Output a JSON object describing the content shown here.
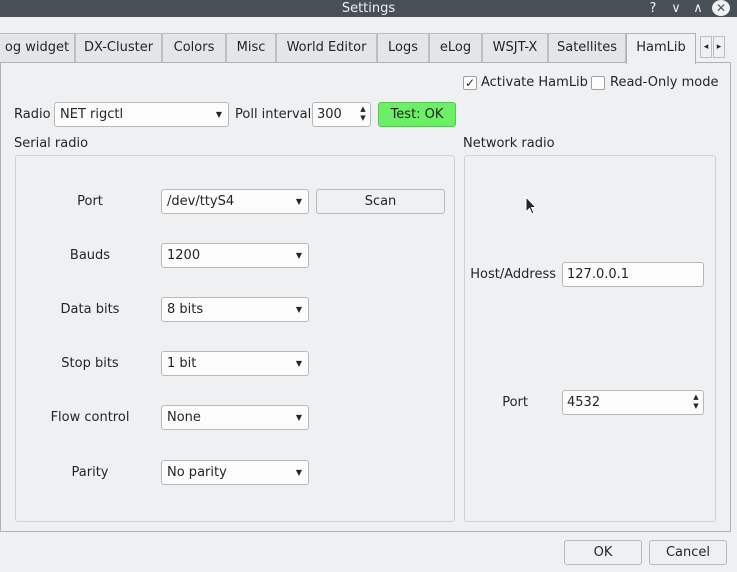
{
  "window": {
    "title": "Settings",
    "help_glyph": "?",
    "minimize_glyph": "∨",
    "maximize_glyph": "∧",
    "close_glyph": "✕"
  },
  "tabs": [
    {
      "label": "og widget",
      "active": false
    },
    {
      "label": "DX-Cluster",
      "active": false
    },
    {
      "label": "Colors",
      "active": false
    },
    {
      "label": "Misc",
      "active": false
    },
    {
      "label": "World Editor",
      "active": false
    },
    {
      "label": "Logs",
      "active": false
    },
    {
      "label": "eLog",
      "active": false
    },
    {
      "label": "WSJT-X",
      "active": false
    },
    {
      "label": "Satellites",
      "active": false
    },
    {
      "label": "HamLib",
      "active": true
    }
  ],
  "tab_scroll": {
    "left": "◂",
    "right": "▸"
  },
  "hamlib": {
    "activate": {
      "label": "Activate HamLib",
      "checked": true,
      "check_glyph": "✓"
    },
    "readonly": {
      "label": "Read-Only mode",
      "checked": false
    },
    "radio_label": "Radio",
    "radio_value": "NET rigctl",
    "poll_label": "Poll interval",
    "poll_value": "300",
    "test_button": "Test: OK",
    "serial": {
      "title": "Serial radio",
      "port_label": "Port",
      "port_value": "/dev/ttyS4",
      "scan_button": "Scan",
      "bauds_label": "Bauds",
      "bauds_value": "1200",
      "databits_label": "Data bits",
      "databits_value": "8 bits",
      "stopbits_label": "Stop bits",
      "stopbits_value": "1 bit",
      "flow_label": "Flow control",
      "flow_value": "None",
      "parity_label": "Parity",
      "parity_value": "No parity"
    },
    "network": {
      "title": "Network radio",
      "host_label": "Host/Address",
      "host_value": "127.0.0.1",
      "port_label": "Port",
      "port_value": "4532"
    }
  },
  "dialog_buttons": {
    "ok": "OK",
    "cancel": "Cancel"
  },
  "glyphs": {
    "dropdown": "▼",
    "spin_up": "▲",
    "spin_down": "▼"
  },
  "colors": {
    "titlebar": "#475057",
    "test_ok": "#6cef67",
    "window_bg": "#eff0f1"
  }
}
